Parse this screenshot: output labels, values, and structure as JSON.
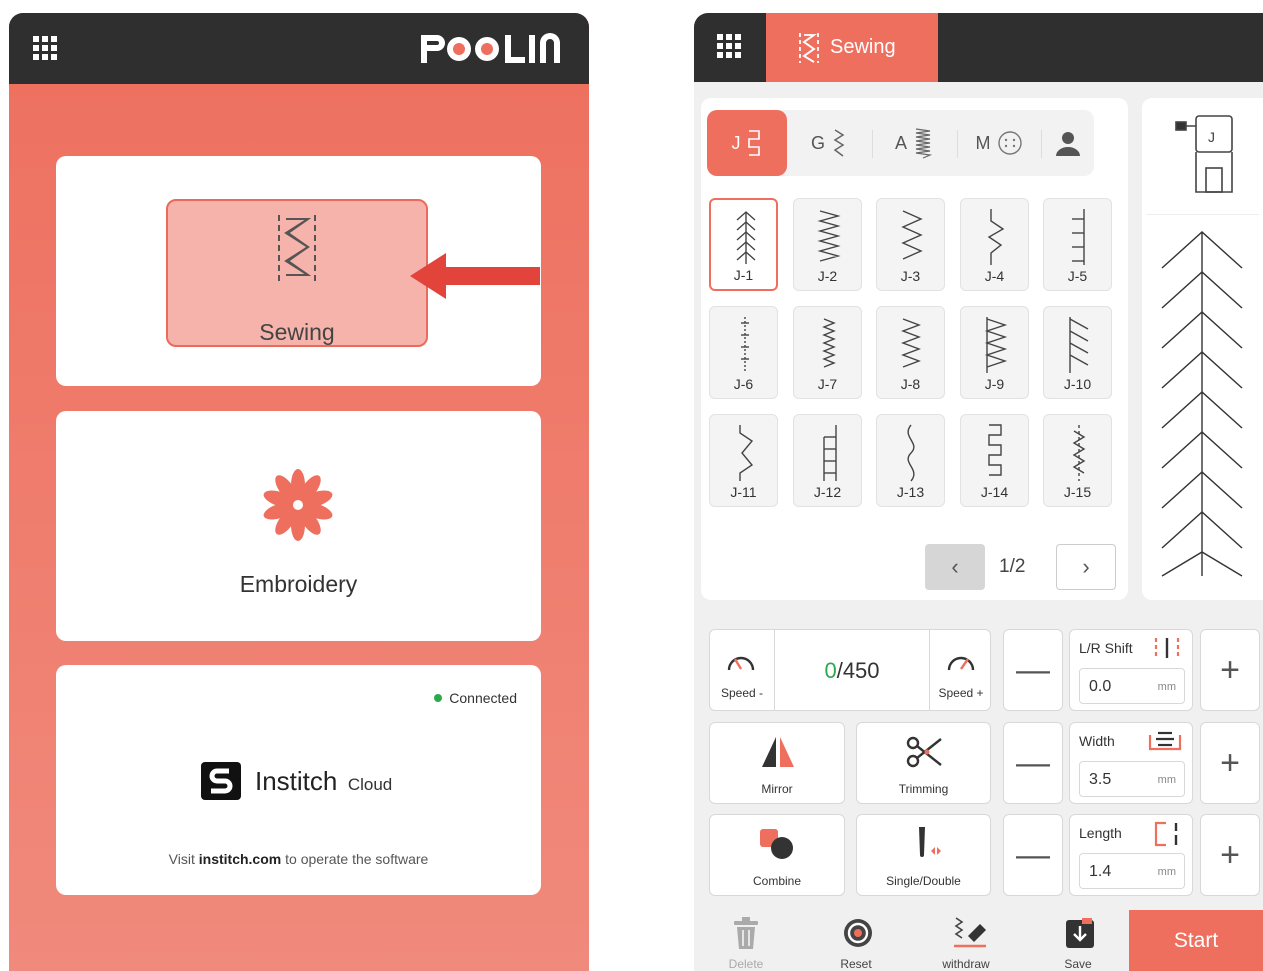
{
  "left_screen": {
    "logo_text": "POOLIN",
    "modes": {
      "sewing_label": "Sewing",
      "embroidery_label": "Embroidery"
    },
    "cloud": {
      "status": "Connected",
      "brand": "Institch",
      "brand_suffix": "Cloud",
      "visit_prefix": "Visit",
      "visit_link": "institch.com",
      "visit_suffix": "to operate the software"
    }
  },
  "right_screen": {
    "active_tab": "Sewing",
    "categories": [
      {
        "letter": "J",
        "active": true
      },
      {
        "letter": "G",
        "active": false
      },
      {
        "letter": "A",
        "active": false
      },
      {
        "letter": "M",
        "active": false
      },
      {
        "letter": "",
        "active": false,
        "icon": "user-icon"
      }
    ],
    "patterns": [
      "J-1",
      "J-2",
      "J-3",
      "J-4",
      "J-5",
      "J-6",
      "J-7",
      "J-8",
      "J-9",
      "J-10",
      "J-11",
      "J-12",
      "J-13",
      "J-14",
      "J-15"
    ],
    "selected_pattern": "J-1",
    "page": "1/2",
    "speed": {
      "counter_current": "0",
      "counter_total": "/450",
      "minus_label": "Speed -",
      "plus_label": "Speed +"
    },
    "buttons": {
      "mirror": "Mirror",
      "trimming": "Trimming",
      "combine": "Combine",
      "single_double": "Single/Double"
    },
    "params": {
      "lr_shift": {
        "title": "L/R Shift",
        "value": "0.0",
        "unit": "mm"
      },
      "width": {
        "title": "Width",
        "value": "3.5",
        "unit": "mm"
      },
      "length": {
        "title": "Length",
        "value": "1.4",
        "unit": "mm"
      }
    },
    "bottom_bar": {
      "delete": "Delete",
      "reset": "Reset",
      "withdraw": "withdraw",
      "save": "Save",
      "start": "Start"
    },
    "colors": {
      "accent": "#ee6f5e",
      "dark_bar": "#2f2f2f",
      "connected": "#2ea84c"
    }
  }
}
